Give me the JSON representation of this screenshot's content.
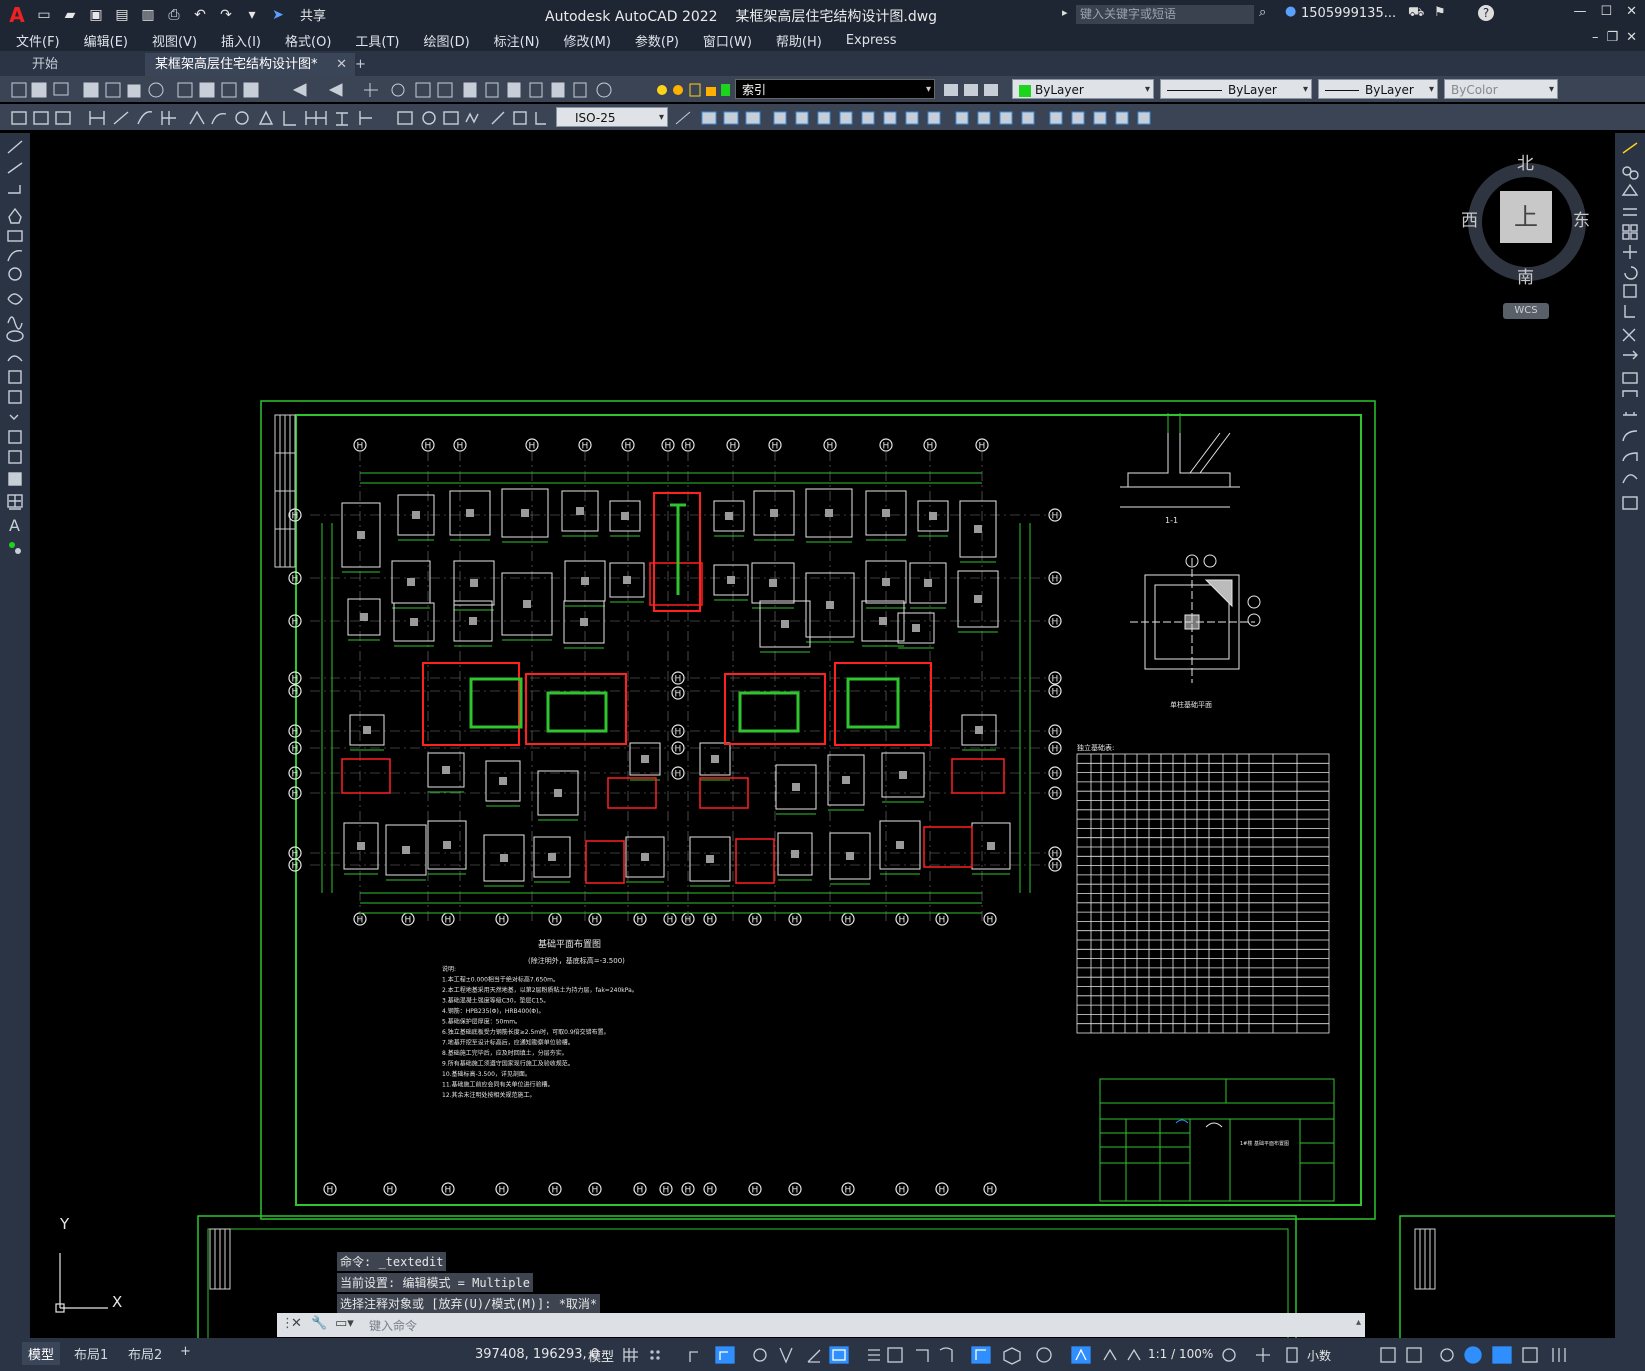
{
  "titlebar": {
    "logo": "A",
    "share": "共享",
    "title": "Autodesk AutoCAD 2022    某框架高层住宅结构设计图.dwg",
    "search_placeholder": "键入关键字或短语",
    "user": "1505999135...",
    "help": "?"
  },
  "menu": {
    "items": [
      "文件(F)",
      "编辑(E)",
      "视图(V)",
      "插入(I)",
      "格式(O)",
      "工具(T)",
      "绘图(D)",
      "标注(N)",
      "修改(M)",
      "参数(P)",
      "窗口(W)",
      "帮助(H)",
      "Express"
    ]
  },
  "tabs": {
    "start": "开始",
    "doc": "某框架高层住宅结构设计图*",
    "close": "✕",
    "add": "+"
  },
  "toolbar": {
    "layer": "索引",
    "color": "ByLayer",
    "linetype": "ByLayer",
    "lineweight": "ByLayer",
    "plotstyle": "ByColor",
    "dimstyle": "ISO-25"
  },
  "viewcube": {
    "north": "北",
    "south": "南",
    "east": "东",
    "west": "西",
    "face": "上",
    "wcs": "WCS"
  },
  "ucs": {
    "y": "Y",
    "x": "X"
  },
  "drawing": {
    "plan_title": "基础平面布置图",
    "plan_subtitle": "(除注明外，基底标高=-3.500)",
    "section_label": "1-1",
    "detail_title": "单柱基础平面",
    "table_title": "独立基础表:",
    "title_block": "1#楼 基础平面布置图",
    "axis_top": [
      "H",
      "H",
      "H",
      "H",
      "H",
      "H",
      "H",
      "H",
      "H",
      "H",
      "H",
      "H",
      "H",
      "H",
      "H"
    ],
    "notes": [
      "说明:",
      "1.本工程±0.000相当于绝对标高7.650m。",
      "2.本工程地基采用天然地基，以第2层粉质粘土为持力层，fak=240kPa。",
      "3.基础混凝土强度等级C30，垫层C15。",
      "4.钢筋：HPB235(Φ)，HRB400(Φ)。",
      "5.基础保护层厚度：50mm。",
      "6.独立基础底板受力钢筋长度≥2.5m时，可取0.9倍交错布置。",
      "7.地基开挖至设计标高后，应通知勘察单位验槽。",
      "8.基础施工完毕后，应及时回填土，分层夯实。",
      "9.所有基础施工须遵守国家现行施工及验收规范。",
      "10.基础标高-3.500，详见剖面。",
      "11.基础施工前应会同有关单位进行验槽。",
      "12.其余未注明处按相关规范施工。"
    ]
  },
  "command": {
    "history": [
      "命令: _textedit",
      "当前设置: 编辑模式 = Multiple",
      "选择注释对象或 [放弃(U)/模式(M)]: *取消*"
    ],
    "placeholder": "键入命令"
  },
  "status": {
    "model_tab": "模型",
    "layout1": "布局1",
    "layout2": "布局2",
    "add": "+",
    "coords": "397408, 196293, 0",
    "space": "模型",
    "scale": "1:1 / 100%",
    "units": "小数"
  },
  "colors": {
    "accent": "#2f8fff",
    "frame_green": "#2ec52e",
    "red": "#ff2020",
    "white": "#ffffff"
  }
}
